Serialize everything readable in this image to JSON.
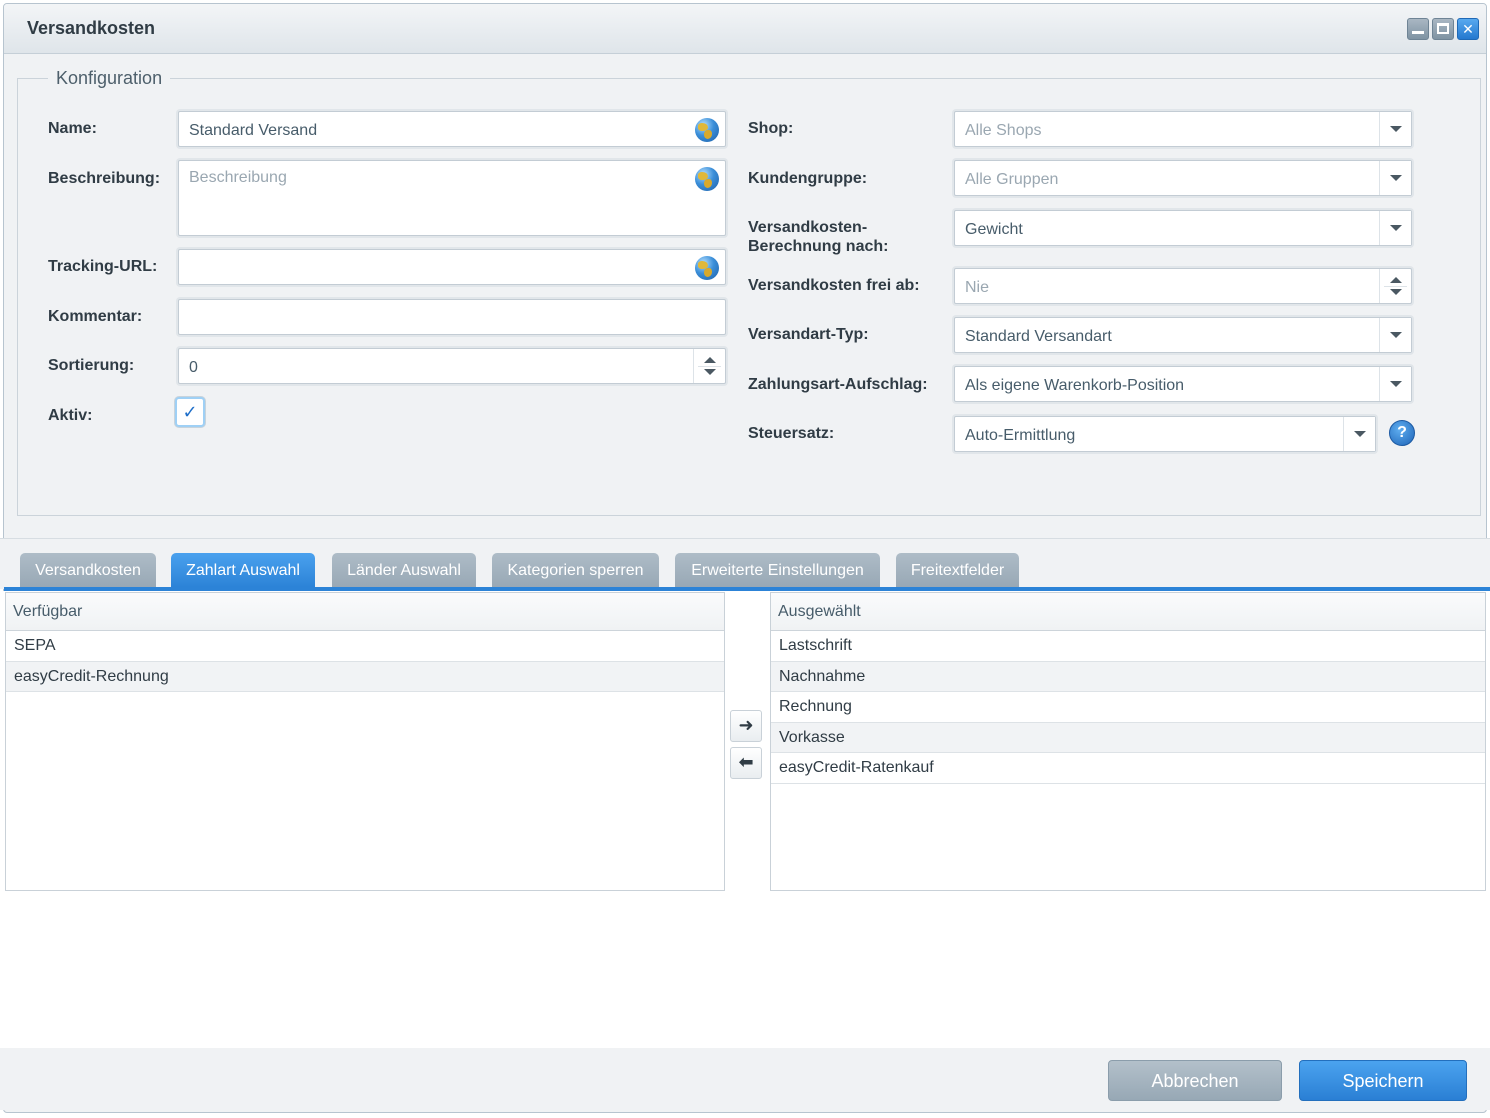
{
  "window": {
    "title": "Versandkosten"
  },
  "config": {
    "legend": "Konfiguration",
    "left": {
      "name_label": "Name:",
      "name_value": "Standard Versand",
      "description_label": "Beschreibung:",
      "description_placeholder": "Beschreibung",
      "tracking_label": "Tracking-URL:",
      "tracking_value": "",
      "comment_label": "Kommentar:",
      "comment_value": "",
      "sort_label": "Sortierung:",
      "sort_value": "0",
      "active_label": "Aktiv:",
      "active_checked": true,
      "active_check_glyph": "✓"
    },
    "right": {
      "shop_label": "Shop:",
      "shop_placeholder": "Alle Shops",
      "customer_group_label": "Kundengruppe:",
      "customer_group_placeholder": "Alle Gruppen",
      "calc_label_line1": "Versandkosten-",
      "calc_label_line2": "Berechnung nach:",
      "calc_value": "Gewicht",
      "free_from_label": "Versandkosten frei ab:",
      "free_from_placeholder": "Nie",
      "type_label": "Versandart-Typ:",
      "type_value": "Standard Versandart",
      "surcharge_label": "Zahlungsart-Aufschlag:",
      "surcharge_value": "Als eigene Warenkorb-Position",
      "tax_label": "Steuersatz:",
      "tax_value": "Auto-Ermittlung",
      "help_glyph": "?"
    }
  },
  "tabs": [
    {
      "label": "Versandkosten",
      "active": false
    },
    {
      "label": "Zahlart Auswahl",
      "active": true
    },
    {
      "label": "Länder Auswahl",
      "active": false
    },
    {
      "label": "Kategorien sperren",
      "active": false
    },
    {
      "label": "Erweiterte Einstellungen",
      "active": false
    },
    {
      "label": "Freitextfelder",
      "active": false
    }
  ],
  "payment": {
    "available_header": "Verfügbar",
    "available": [
      "SEPA",
      "easyCredit-Rechnung"
    ],
    "selected_header": "Ausgewählt",
    "selected": [
      "Lastschrift",
      "Nachnahme",
      "Rechnung",
      "Vorkasse",
      "easyCredit-Ratenkauf"
    ],
    "move_right_glyph": "➜",
    "move_left_glyph": "⬅"
  },
  "footer": {
    "cancel_label": "Abbrechen",
    "save_label": "Speichern"
  },
  "colors": {
    "accent": "#2c83d7",
    "tab_inactive": "#a3b2be",
    "window_bg": "#f0f2f4"
  },
  "window_controls": {
    "close_glyph": "✕"
  }
}
